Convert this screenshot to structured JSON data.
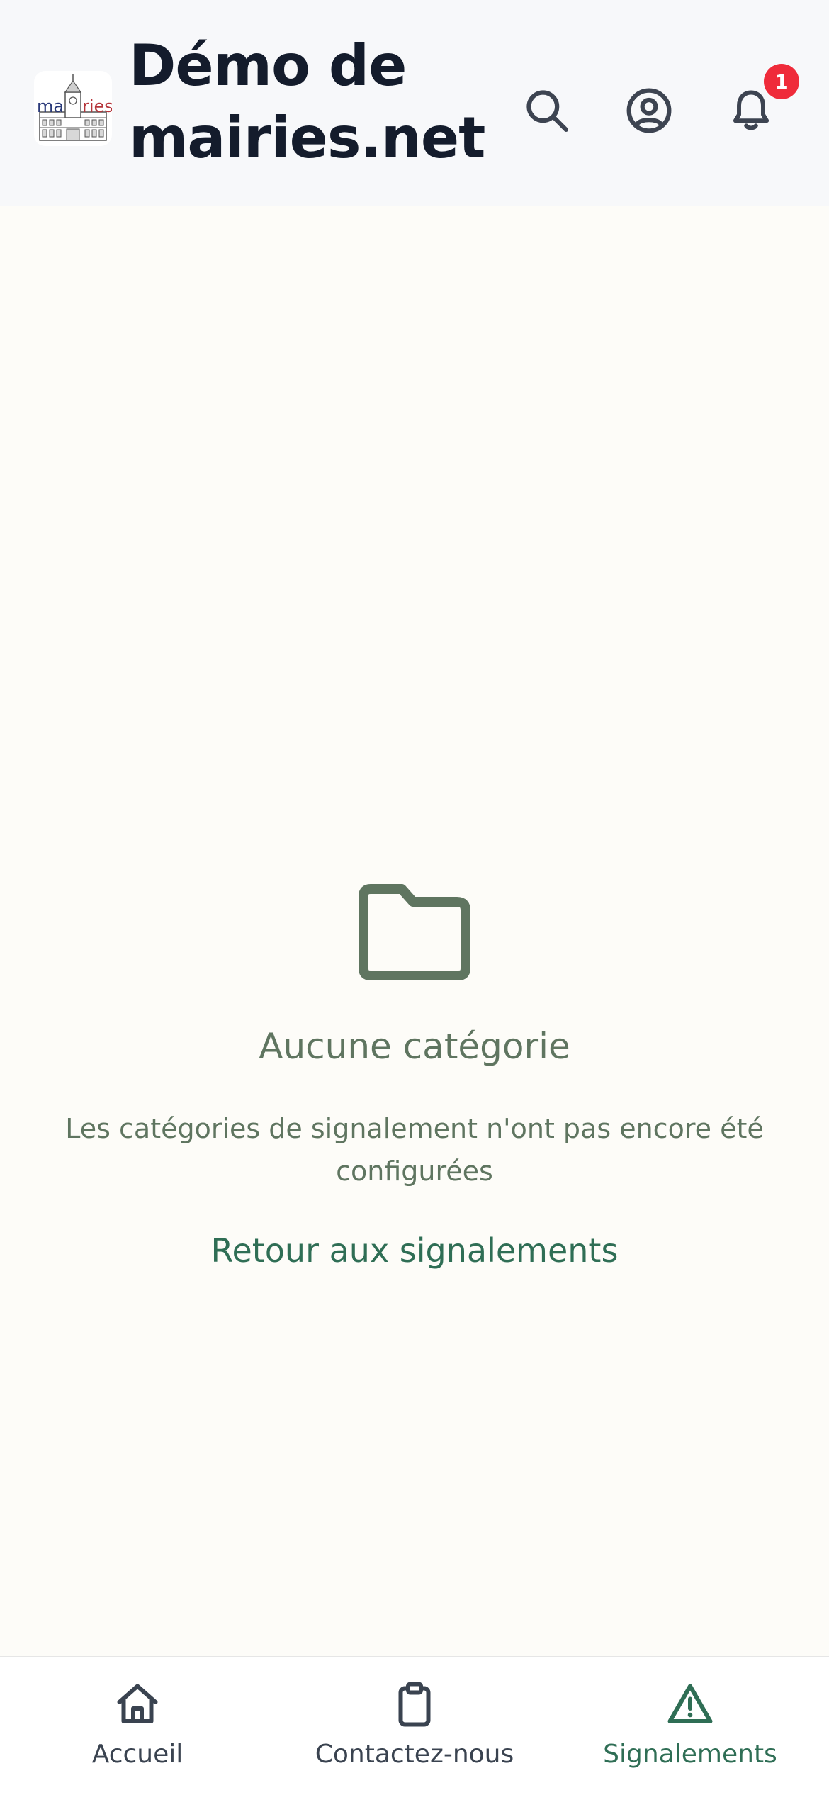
{
  "header": {
    "title": "Démo de mairies.net",
    "logo_text_left": "ma",
    "logo_text_right": "ries",
    "search_icon": "search-icon",
    "account_icon": "user-circle-icon",
    "notifications_icon": "bell-icon",
    "notification_count": "1"
  },
  "empty_state": {
    "icon": "folder-icon",
    "title": "Aucune catégorie",
    "description": "Les catégories de signalement n'ont pas encore été configurées",
    "back_link": "Retour aux signalements"
  },
  "bottom_nav": {
    "items": [
      {
        "label": "Accueil",
        "icon": "home-icon",
        "active": false
      },
      {
        "label": "Contactez-nous",
        "icon": "clipboard-icon",
        "active": false
      },
      {
        "label": "Signalements",
        "icon": "warning-icon",
        "active": true
      }
    ]
  },
  "colors": {
    "accent": "#2f6e55",
    "muted_green": "#5f7560",
    "badge": "#ef2b3a",
    "header_bg": "#f7f8fa",
    "page_bg": "#fdfcf8",
    "title": "#141c2c"
  }
}
